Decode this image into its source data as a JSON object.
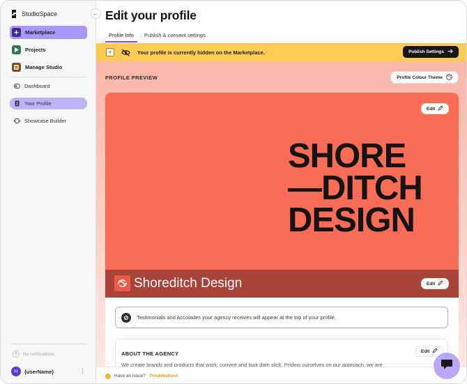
{
  "app": {
    "name": "StudioSpace"
  },
  "sidebar": {
    "primary": [
      {
        "label": "Marketplace",
        "icon": "marketplace-icon",
        "active": true
      },
      {
        "label": "Projects",
        "icon": "projects-icon",
        "active": false
      },
      {
        "label": "Manage Studio",
        "icon": "manage-studio-icon",
        "active": false
      }
    ],
    "secondary": [
      {
        "label": "Dashboard",
        "icon": "dashboard-icon",
        "active": false
      },
      {
        "label": "Your Profile",
        "icon": "profile-icon",
        "active": true
      },
      {
        "label": "Showcase Builder",
        "icon": "showcase-icon",
        "active": false
      }
    ],
    "notifications": {
      "count": "0",
      "label": "No notifications."
    },
    "user": {
      "initials": "LI",
      "name": "{userName}"
    }
  },
  "page": {
    "title": "Edit your profile",
    "tabs": [
      {
        "label": "Profile Info",
        "active": true
      },
      {
        "label": "Publish & consent settings",
        "active": false
      }
    ]
  },
  "banner": {
    "message": "Your profile is currently hidden on the Marketplace.",
    "publish_label": "Publish Settings",
    "add_label": "+"
  },
  "preview": {
    "label": "PROFILE PREVIEW",
    "theme_button": "Profile Colour Theme",
    "hero_logo_lines": [
      "SHORE",
      "—DITCH",
      "DESIGN"
    ],
    "studio_name": "Shoreditch Design",
    "edit_label": "Edit",
    "notice": "Testimonials and Accolades your agency receives will appear at the top of your profile.",
    "about_title": "ABOUT THE AGENCY",
    "about_text": "We create brands and products that work, convert and look dam slick. Priding ourselves on our approach, we are"
  },
  "footer": {
    "issue_text": "Have an issue?",
    "troubleshoot_label": "Troubleshoot"
  },
  "colors": {
    "accent": "#a996f7",
    "banner": "#ffcb57",
    "hero": "#fb6c57",
    "name_bar": "#a94238"
  }
}
